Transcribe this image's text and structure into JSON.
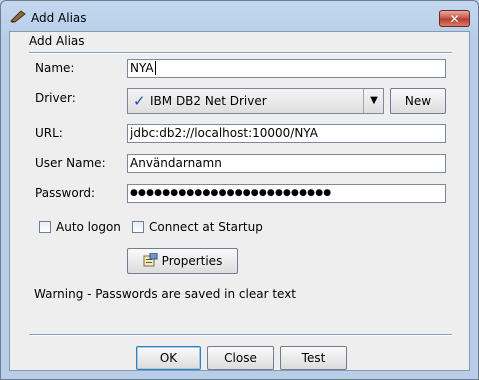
{
  "window": {
    "title": "Add Alias",
    "close_glyph": "✕",
    "app_icon": "pencil-icon"
  },
  "group_title": "Add Alias",
  "form": {
    "name_label": "Name:",
    "name_value": "NYA",
    "driver_label": "Driver:",
    "driver_value": "IBM DB2 Net Driver",
    "driver_check_glyph": "✓",
    "driver_arrow_glyph": "▼",
    "new_button": "New",
    "url_label": "URL:",
    "url_value": "jdbc:db2://localhost:10000/NYA",
    "user_label": "User Name:",
    "user_value": "Användarnamn",
    "password_label": "Password:",
    "password_value": "●●●●●●●●●●●●●●●●●●●●●●●●●"
  },
  "options": {
    "auto_logon_label": "Auto logon",
    "auto_logon_checked": false,
    "connect_startup_label": "Connect at Startup",
    "connect_startup_checked": false
  },
  "properties_button": "Properties",
  "warning": "Warning - Passwords are saved in clear text",
  "buttons": {
    "ok": "OK",
    "close": "Close",
    "test": "Test"
  }
}
